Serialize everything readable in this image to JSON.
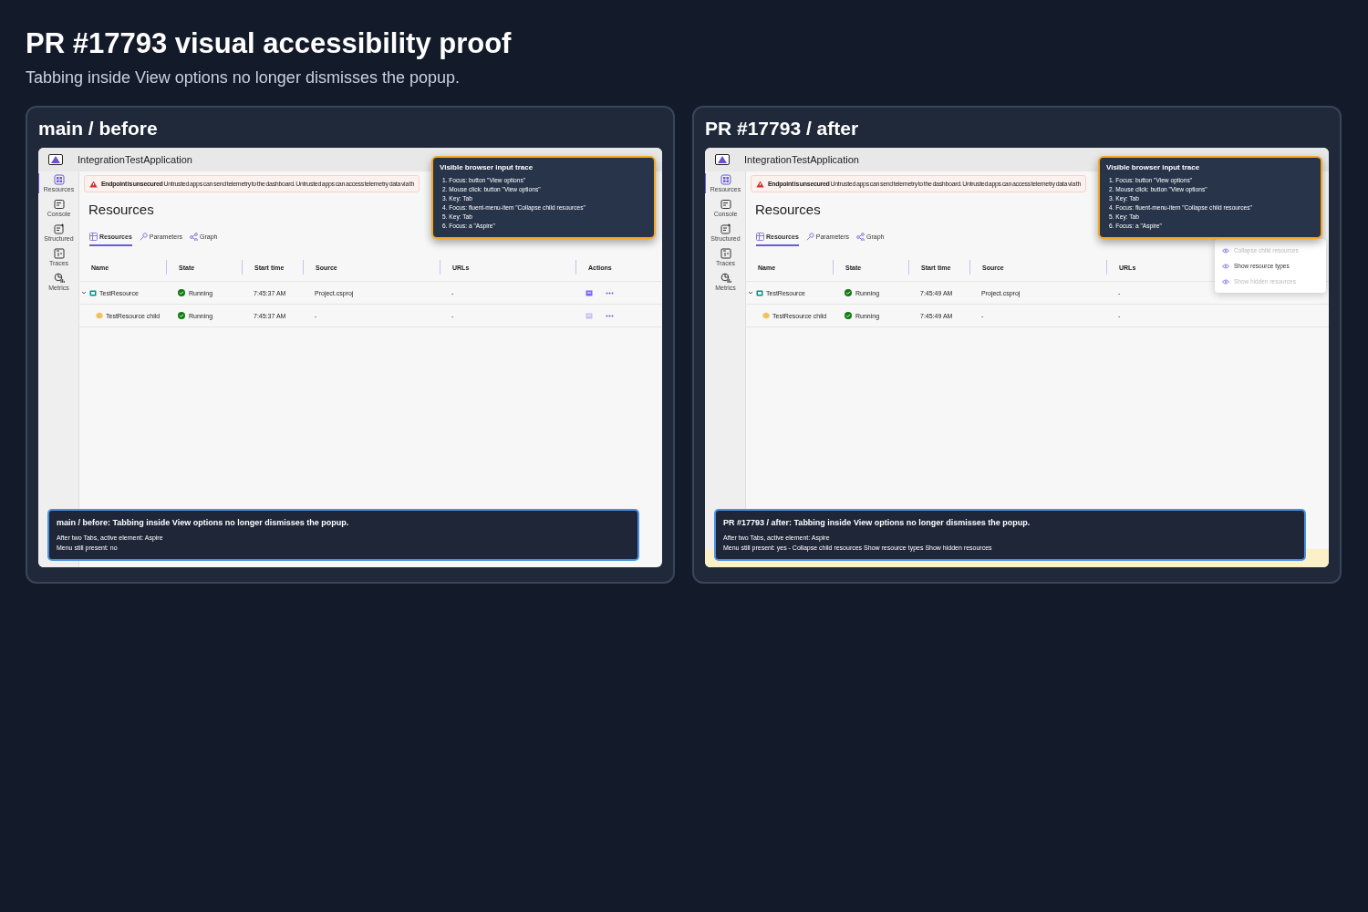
{
  "page": {
    "title": "PR #17793 visual accessibility proof",
    "subtitle": "Tabbing inside View options no longer dismisses the popup."
  },
  "panels": [
    {
      "heading": "main / before",
      "app": {
        "title": "IntegrationTestApplication",
        "nav": [
          {
            "label": "Resources",
            "selected": true
          },
          {
            "label": "Console",
            "selected": false
          },
          {
            "label": "Structured",
            "selected": false
          },
          {
            "label": "Traces",
            "selected": false
          },
          {
            "label": "Metrics",
            "selected": false
          }
        ],
        "banner": {
          "title": "Endpoint is unsecured",
          "text": "Untrusted apps can send telemetry to the dashboard. Untrusted apps can access telemetry data via th"
        },
        "heading": "Resources",
        "tabs": [
          {
            "label": "Resources",
            "selected": true
          },
          {
            "label": "Parameters",
            "selected": false
          },
          {
            "label": "Graph",
            "selected": false
          }
        ],
        "columns": [
          "Name",
          "State",
          "Start time",
          "Source",
          "URLs",
          "Actions"
        ],
        "rows": [
          {
            "name": "TestResource",
            "kind": "project",
            "expanded": true,
            "state": "Running",
            "start_time": "7:45:37 AM",
            "source": "Project.csproj",
            "urls": "-",
            "children": [
              {
                "name": "TestResource child",
                "kind": "child",
                "state": "Running",
                "start_time": "7:45:37 AM",
                "source": "-",
                "urls": "-"
              }
            ]
          }
        ]
      },
      "trace": {
        "title": "Visible browser input trace",
        "steps": [
          "1. Focus: button \"View options\"",
          "2. Mouse click: button \"View options\"",
          "3. Key: Tab",
          "4. Focus: fluent-menu-item \"Collapse child resources\"",
          "5. Key: Tab",
          "6. Focus: a \"Aspire\""
        ]
      },
      "summary": {
        "title": "main / before: Tabbing inside View options no longer dismisses the popup.",
        "lines": [
          "After two Tabs, active element: Aspire",
          "Menu still present: no"
        ]
      }
    },
    {
      "heading": "PR #17793 / after",
      "app": {
        "title": "IntegrationTestApplication",
        "error_bar": true,
        "nav": [
          {
            "label": "Resources",
            "selected": true
          },
          {
            "label": "Console",
            "selected": false
          },
          {
            "label": "Structured",
            "selected": false
          },
          {
            "label": "Traces",
            "selected": false
          },
          {
            "label": "Metrics",
            "selected": false
          }
        ],
        "banner": {
          "title": "Endpoint is unsecured",
          "text": "Untrusted apps can send telemetry to the dashboard. Untrusted apps can access telemetry data via th"
        },
        "heading": "Resources",
        "tabs": [
          {
            "label": "Resources",
            "selected": true
          },
          {
            "label": "Parameters",
            "selected": false
          },
          {
            "label": "Graph",
            "selected": false
          }
        ],
        "columns": [
          "Name",
          "State",
          "Start time",
          "Source",
          "URLs"
        ],
        "rows": [
          {
            "name": "TestResource",
            "kind": "project",
            "expanded": true,
            "state": "Running",
            "start_time": "7:45:49 AM",
            "source": "Project.csproj",
            "urls": "-",
            "children": [
              {
                "name": "TestResource child",
                "kind": "child",
                "state": "Running",
                "start_time": "7:45:49 AM",
                "source": "-",
                "urls": "-"
              }
            ]
          }
        ]
      },
      "menu": {
        "items": [
          {
            "label": "Collapse child resources",
            "disabled": true
          },
          {
            "label": "Show resource types",
            "disabled": false
          },
          {
            "label": "Show hidden resources",
            "disabled": true
          }
        ]
      },
      "trace": {
        "title": "Visible browser input trace",
        "steps": [
          "1. Focus: button \"View options\"",
          "2. Mouse click: button \"View options\"",
          "3. Key: Tab",
          "4. Focus: fluent-menu-item \"Collapse child resources\"",
          "5. Key: Tab",
          "6. Focus: a \"Aspire\""
        ]
      },
      "summary": {
        "title": "PR #17793 / after: Tabbing inside View options no longer dismisses the popup.",
        "lines": [
          "After two Tabs, active element: Aspire",
          "Menu still present: yes - Collapse child resources Show resource types Show hidden resources"
        ]
      }
    }
  ]
}
